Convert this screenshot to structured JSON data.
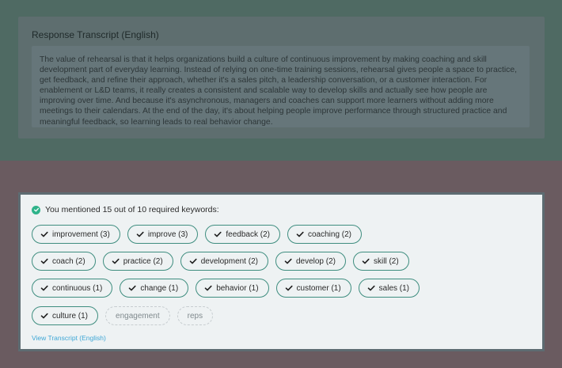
{
  "colors": {
    "top_background": "#4f6a63",
    "bottom_background": "#6a5b60",
    "accent_green": "#2eb38a",
    "chip_border": "#3e8d7f",
    "link_blue": "#3fa7d6"
  },
  "transcript": {
    "title": "Response Transcript (English)",
    "text": "The value of rehearsal is that it helps organizations build a culture of continuous improvement by making coaching and skill development part of everyday learning. Instead of relying on one-time training sessions, rehearsal gives people a space to practice, get feedback, and refine their approach, whether it's a sales pitch, a leadership conversation, or a customer interaction. For enablement or L&D teams, it really creates a consistent and scalable way to develop skills and actually see how people are improving over time. And because it's asynchronous, managers and coaches can support more learners without adding more meetings to their calendars. At the end of the day, it's about helping people improve performance through structured practice and meaningful feedback, so learning leads to real behavior change."
  },
  "keywords": {
    "summary_icon": "check-circle-icon",
    "summary": "You mentioned 15 out of 10 required keywords:",
    "rows": [
      [
        {
          "label": "improvement (3)",
          "matched": true
        },
        {
          "label": "improve (3)",
          "matched": true
        },
        {
          "label": "feedback (2)",
          "matched": true
        },
        {
          "label": "coaching (2)",
          "matched": true
        }
      ],
      [
        {
          "label": "coach (2)",
          "matched": true
        },
        {
          "label": "practice (2)",
          "matched": true
        },
        {
          "label": "development (2)",
          "matched": true
        },
        {
          "label": "develop (2)",
          "matched": true
        },
        {
          "label": "skill (2)",
          "matched": true
        }
      ],
      [
        {
          "label": "continuous (1)",
          "matched": true
        },
        {
          "label": "change (1)",
          "matched": true
        },
        {
          "label": "behavior (1)",
          "matched": true
        },
        {
          "label": "customer (1)",
          "matched": true
        },
        {
          "label": "sales (1)",
          "matched": true
        }
      ],
      [
        {
          "label": "culture (1)",
          "matched": true
        },
        {
          "label": "engagement",
          "matched": false
        },
        {
          "label": "reps",
          "matched": false
        }
      ]
    ],
    "view_link": "View Transcript (English)"
  }
}
